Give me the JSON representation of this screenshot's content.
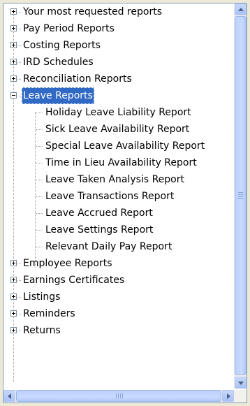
{
  "tree": {
    "items": [
      {
        "label": "Your most requested reports",
        "level": 0,
        "expander": "plus"
      },
      {
        "label": "Pay Period Reports",
        "level": 0,
        "expander": "plus"
      },
      {
        "label": "Costing Reports",
        "level": 0,
        "expander": "plus"
      },
      {
        "label": "IRD Schedules",
        "level": 0,
        "expander": "plus"
      },
      {
        "label": "Reconciliation Reports",
        "level": 0,
        "expander": "plus"
      },
      {
        "label": "Leave Reports",
        "level": 0,
        "expander": "minus",
        "selected": true
      },
      {
        "label": "Holiday Leave Liability Report",
        "level": 1
      },
      {
        "label": "Sick Leave Availability Report",
        "level": 1
      },
      {
        "label": "Special Leave Availability Report",
        "level": 1
      },
      {
        "label": "Time in Lieu Availability Report",
        "level": 1
      },
      {
        "label": "Leave Taken Analysis Report",
        "level": 1
      },
      {
        "label": "Leave Transactions Report",
        "level": 1
      },
      {
        "label": "Leave Accrued Report",
        "level": 1
      },
      {
        "label": "Leave Settings Report",
        "level": 1
      },
      {
        "label": "Relevant Daily Pay Report",
        "level": 1
      },
      {
        "label": "Employee Reports",
        "level": 0,
        "expander": "plus"
      },
      {
        "label": "Earnings Certificates",
        "level": 0,
        "expander": "plus"
      },
      {
        "label": "Listings",
        "level": 0,
        "expander": "plus"
      },
      {
        "label": "Reminders",
        "level": 0,
        "expander": "plus"
      },
      {
        "label": "Returns",
        "level": 0,
        "expander": "plus"
      }
    ]
  },
  "icons": {
    "scroll_up": "arrow-up-icon",
    "scroll_down": "arrow-down-icon",
    "scroll_left": "arrow-left-icon",
    "scroll_right": "arrow-right-icon"
  },
  "colors": {
    "selection": "#316ac5",
    "panel_border": "#7f9db9",
    "scrollbar_thumb": "#c1d3fb"
  }
}
